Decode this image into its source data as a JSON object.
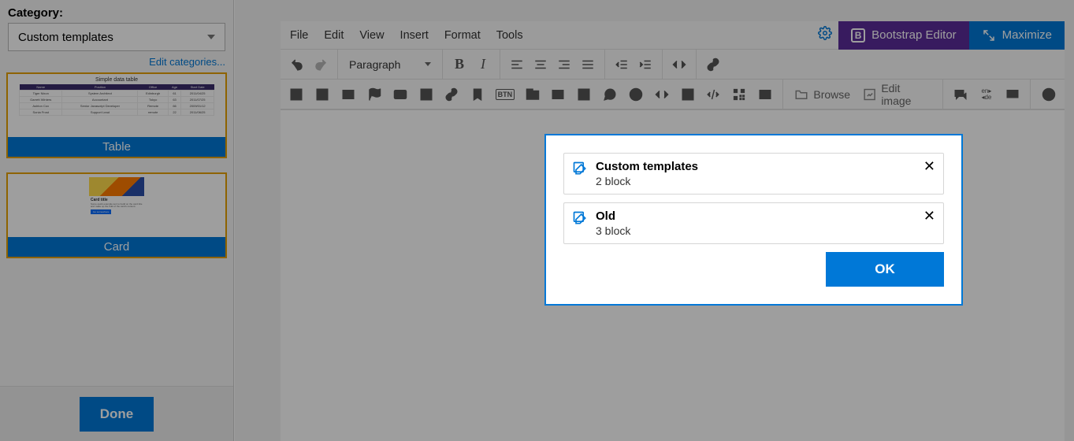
{
  "sidebar": {
    "category_label": "Category:",
    "category_value": "Custom templates",
    "edit_categories": "Edit categories...",
    "done": "Done",
    "templates": [
      {
        "label": "Table",
        "preview_title": "Simple data table"
      },
      {
        "label": "Card",
        "preview_title": "Card title",
        "preview_text": "Some quick example text to build on the card title and make up the bulk of the card's content.",
        "preview_btn": "Go somewhere"
      }
    ]
  },
  "menubar": {
    "items": [
      "File",
      "Edit",
      "View",
      "Insert",
      "Format",
      "Tools"
    ],
    "bootstrap": "Bootstrap Editor",
    "maximize": "Maximize"
  },
  "toolbar": {
    "paragraph": "Paragraph",
    "browse": "Browse",
    "edit_image": "Edit image"
  },
  "modal": {
    "items": [
      {
        "title": "Custom templates",
        "sub": "2 block"
      },
      {
        "title": "Old",
        "sub": "3 block"
      }
    ],
    "ok": "OK"
  }
}
